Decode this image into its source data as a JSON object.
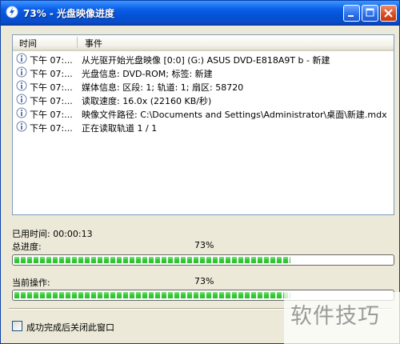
{
  "window": {
    "title": "73% - 光盘映像进度"
  },
  "event_log": {
    "columns": [
      "时间",
      "事件"
    ],
    "rows": [
      {
        "time": "下午 07:...",
        "event": "从光驱开始光盘映像 [0:0] (G:) ASUS DVD-E818A9T  b - 新建"
      },
      {
        "time": "下午 07:...",
        "event": "光盘信息: DVD-ROM; 标签: 新建"
      },
      {
        "time": "下午 07:...",
        "event": "媒体信息: 区段: 1; 轨道: 1; 扇区: 58720"
      },
      {
        "time": "下午 07:...",
        "event": "读取速度: 16.0x (22160 KB/秒)"
      },
      {
        "time": "下午 07:...",
        "event": "映像文件路径: C:\\Documents and Settings\\Administrator\\桌面\\新建.mdx"
      },
      {
        "time": "下午 07:...",
        "event": "正在读取轨道 1 / 1"
      }
    ]
  },
  "status": {
    "elapsed_label": "已用时间:",
    "elapsed_value": "00:00:13",
    "total_label": "总进度:",
    "total_percent_text": "73%",
    "total_progress": 0.73,
    "current_label": "当前操作:",
    "current_percent_text": "73%",
    "current_progress": 0.73
  },
  "options": {
    "close_on_success_label": "成功完成后关闭此窗口",
    "close_on_success_checked": false
  },
  "watermark": {
    "text": "软件技巧"
  },
  "colors": {
    "progress_fill": "#33cc33",
    "titlebar": "#0a5fe8"
  }
}
